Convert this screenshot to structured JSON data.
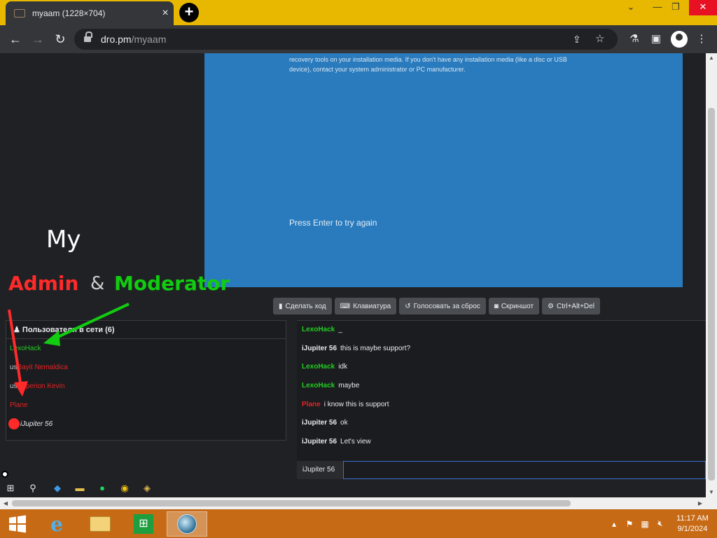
{
  "browser": {
    "tab_title": "myaam (1228×704)",
    "url_host": "dro.pm",
    "url_path": "/myaam"
  },
  "remote": {
    "bsod_message": "recovery tools on your installation media. If you don't have any installation media (like a disc or USB device), contact your system administrator or PC manufacturer.",
    "press_enter": "Press Enter to try again",
    "controls": [
      {
        "label": "Сделать ход",
        "icon": "mouse-icon"
      },
      {
        "label": "Клавиатура",
        "icon": "keyboard-icon"
      },
      {
        "label": "Голосовать за сброс",
        "icon": "reset-icon"
      },
      {
        "label": "Скриншот",
        "icon": "camera-icon"
      },
      {
        "label": "Ctrl+Alt+Del",
        "icon": "gear-icon"
      }
    ]
  },
  "annotation": {
    "my": "My",
    "admin": "Admin",
    "amp": "&",
    "moderator": "Moderator",
    "arrow_green": "#11cc11",
    "arrow_red": "#ff2a2a"
  },
  "users": {
    "header": "Пользователи в сети (6)",
    "list": [
      {
        "prefix": "",
        "name": "LexoHack",
        "color": "green"
      },
      {
        "prefix": "us",
        "name": "Bayit Nemaldica",
        "color": "red"
      },
      {
        "prefix": "us",
        "name": "Hyperion Kevin",
        "color": "red"
      },
      {
        "prefix": "",
        "name": "Plane",
        "color": "red"
      },
      {
        "prefix": "",
        "name": "iJupiter 56",
        "color": "white"
      }
    ]
  },
  "chat": {
    "messages": [
      {
        "user": "LexoHack",
        "color": "green",
        "text": "_"
      },
      {
        "user": "iJupiter 56",
        "color": "white",
        "text": "this is maybe support?"
      },
      {
        "user": "LexoHack",
        "color": "green",
        "text": "idk"
      },
      {
        "user": "LexoHack",
        "color": "green",
        "text": "maybe"
      },
      {
        "user": "Plane",
        "color": "red",
        "text": "i know this is support"
      },
      {
        "user": "iJupiter 56",
        "color": "white",
        "text": "ok"
      },
      {
        "user": "iJupiter 56",
        "color": "white",
        "text": "Let's view"
      }
    ],
    "input_nick": "iJupiter 56",
    "input_value": ""
  },
  "clock": {
    "time": "11:17 AM",
    "date": "9/1/2024"
  },
  "colors": {
    "taskbar": "#c66a16",
    "tabstrip": "#e8b800",
    "bsod": "#2a7bbd"
  }
}
